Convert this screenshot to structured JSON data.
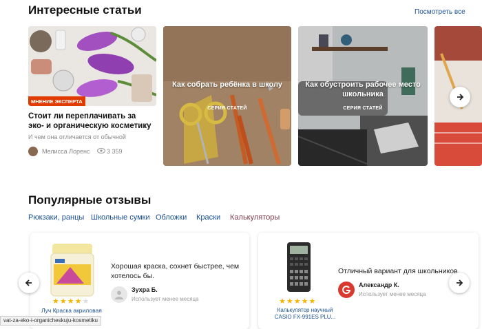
{
  "articles": {
    "title": "Интересные статьи",
    "see_all": "Посмотреть все",
    "cards": [
      {
        "badge": "МНЕНИЕ ЭКСПЕРТА",
        "title": "Стоит ли переплачивать за эко- и органическую косметику",
        "subtitle": "И чем она отличается от обычной",
        "author": "Мелисса Лоренс",
        "views": "3 359"
      },
      {
        "title": "Как собрать ребёнка в школу",
        "series": "СЕРИЯ СТАТЕЙ"
      },
      {
        "title": "Как обустроить рабочее место школьника",
        "series": "СЕРИЯ СТАТЕЙ"
      }
    ]
  },
  "reviews": {
    "title": "Популярные отзывы",
    "tabs": [
      "Рюкзаки, ранцы",
      "Школьные сумки",
      "Обложки",
      "Краски",
      "Калькуляторы"
    ],
    "items": [
      {
        "text": "Хорошая краска, сохнет быстрее, чем хотелось бы.",
        "user": "Зухра Б.",
        "meta": "Использует менее месяца",
        "product": "Луч Краска акриловая",
        "stars": "★★★★",
        "stars_empty": "★",
        "rating": 4,
        "product_label": "ЛУЧ"
      },
      {
        "text": "Отличный вариант для школьников.",
        "user": "Александр К.",
        "meta": "Использует менее месяца",
        "product_line1": "Калькулятор научный",
        "product_line2": "CASIO FX-991ES PLU...",
        "stars": "★★★★★",
        "rating": 5,
        "product_label": "CASIO"
      }
    ]
  },
  "status_url": "vat-za-eko-i-organicheskuju-kosmetiku",
  "colors": {
    "badge": "#e03b00",
    "link": "#1a4f93",
    "star": "#f4b400",
    "avatar_red": "#d93a2f"
  }
}
